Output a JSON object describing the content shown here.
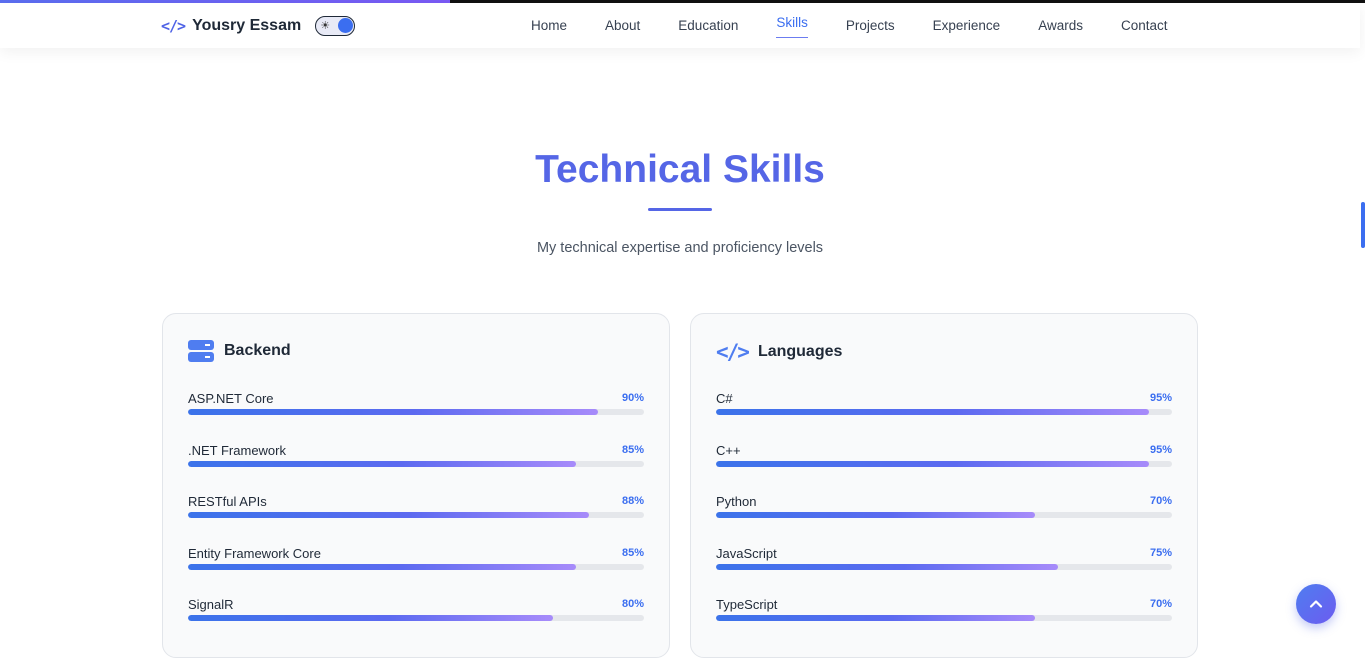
{
  "header": {
    "brand_icon": "</>",
    "brand_name": "Yousry Essam",
    "theme_toggle_icon": "☀",
    "nav": [
      "Home",
      "About",
      "Education",
      "Skills",
      "Projects",
      "Experience",
      "Awards",
      "Contact"
    ],
    "active_nav": "Skills"
  },
  "scroll_progress_percent": 33,
  "section": {
    "title": "Technical Skills",
    "subtitle": "My technical expertise and proficiency levels"
  },
  "cards": [
    {
      "title": "Backend",
      "icon": "server-icon",
      "skills": [
        {
          "name": "ASP.NET Core",
          "percent_label": "90%",
          "value": 90
        },
        {
          "name": ".NET Framework",
          "percent_label": "85%",
          "value": 85
        },
        {
          "name": "RESTful APIs",
          "percent_label": "88%",
          "value": 88
        },
        {
          "name": "Entity Framework Core",
          "percent_label": "85%",
          "value": 85
        },
        {
          "name": "SignalR",
          "percent_label": "80%",
          "value": 80
        }
      ]
    },
    {
      "title": "Languages",
      "icon": "code-icon",
      "icon_glyph": "</>",
      "skills": [
        {
          "name": "C#",
          "percent_label": "95%",
          "value": 95
        },
        {
          "name": "C++",
          "percent_label": "95%",
          "value": 95
        },
        {
          "name": "Python",
          "percent_label": "70%",
          "value": 70
        },
        {
          "name": "JavaScript",
          "percent_label": "75%",
          "value": 75
        },
        {
          "name": "TypeScript",
          "percent_label": "70%",
          "value": 70
        }
      ]
    }
  ],
  "colors": {
    "accent": "#5566e6",
    "link_active": "#3b6ef0",
    "bar_start": "#3b73ea",
    "bar_end": "#a78bfa"
  }
}
